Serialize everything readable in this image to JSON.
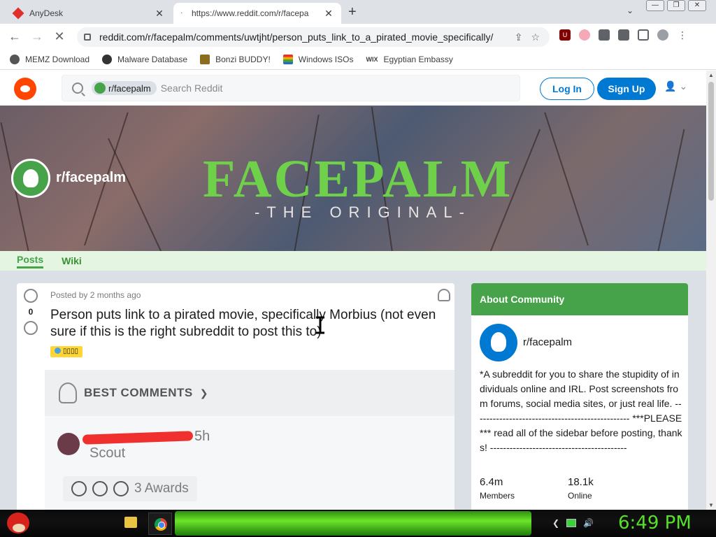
{
  "browser": {
    "tabs": [
      {
        "title": "AnyDesk",
        "close": "✕"
      },
      {
        "title": "https://www.reddit.com/r/facepa",
        "close": "✕"
      }
    ],
    "new_tab": "+",
    "tab_search": "⌄",
    "url": "reddit.com/r/facepalm/comments/uwtjht/person_puts_link_to_a_pirated_movie_specifically/",
    "nav": {
      "back": "←",
      "forward": "→",
      "reload": "✕"
    },
    "bookmarks": [
      {
        "label": "MEMZ Download",
        "color": "#555555"
      },
      {
        "label": "Malware Database",
        "color": "#333333"
      },
      {
        "label": "Bonzi BUDDY!",
        "color": "#8a6d1e"
      },
      {
        "label": "Windows ISOs",
        "color": "#e5332a"
      },
      {
        "label": "Egyptian Embassy",
        "color": "#222222"
      }
    ],
    "bookmark_prefix_wix": "WIX"
  },
  "reddit": {
    "search": {
      "chip": "r/facepalm",
      "placeholder": "Search Reddit"
    },
    "login_label": "Log In",
    "signup_label": "Sign Up",
    "banner": {
      "title": "FACEPALM",
      "subtitle": "-THE ORIGINAL-"
    },
    "subreddit_name": "r/facepalm",
    "subnav": {
      "posts": "Posts",
      "wiki": "Wiki"
    },
    "post": {
      "score": "0",
      "posted_by": "Posted by 2 months ago",
      "title": "Person puts link to a pirated movie, specifically Morbius (not even sure if this is the right subreddit to post this to)",
      "flair": "▯▯▯▯"
    },
    "comments": {
      "sort_label": "BEST COMMENTS",
      "time": "5h",
      "user_flair": "Scout",
      "awards": "3 Awards"
    },
    "about": {
      "heading": "About Community",
      "name": "r/facepalm",
      "description": "*A subreddit for you to share the stupidity of individuals online and IRL. Post screenshots from forums, social media sites, or just real life. ------------------------------------------------ ***PLEASE*** read all of the sidebar before posting, thanks! ------------------------------------------",
      "members_value": "6.4m",
      "members_label": "Members",
      "online_value": "18.1k",
      "online_label": "Online"
    }
  },
  "taskbar": {
    "clock": "6:49 PM"
  },
  "colors": {
    "accent": "#46a34a",
    "reddit_blue": "#0079d3",
    "reddit_orange": "#ff4500"
  }
}
